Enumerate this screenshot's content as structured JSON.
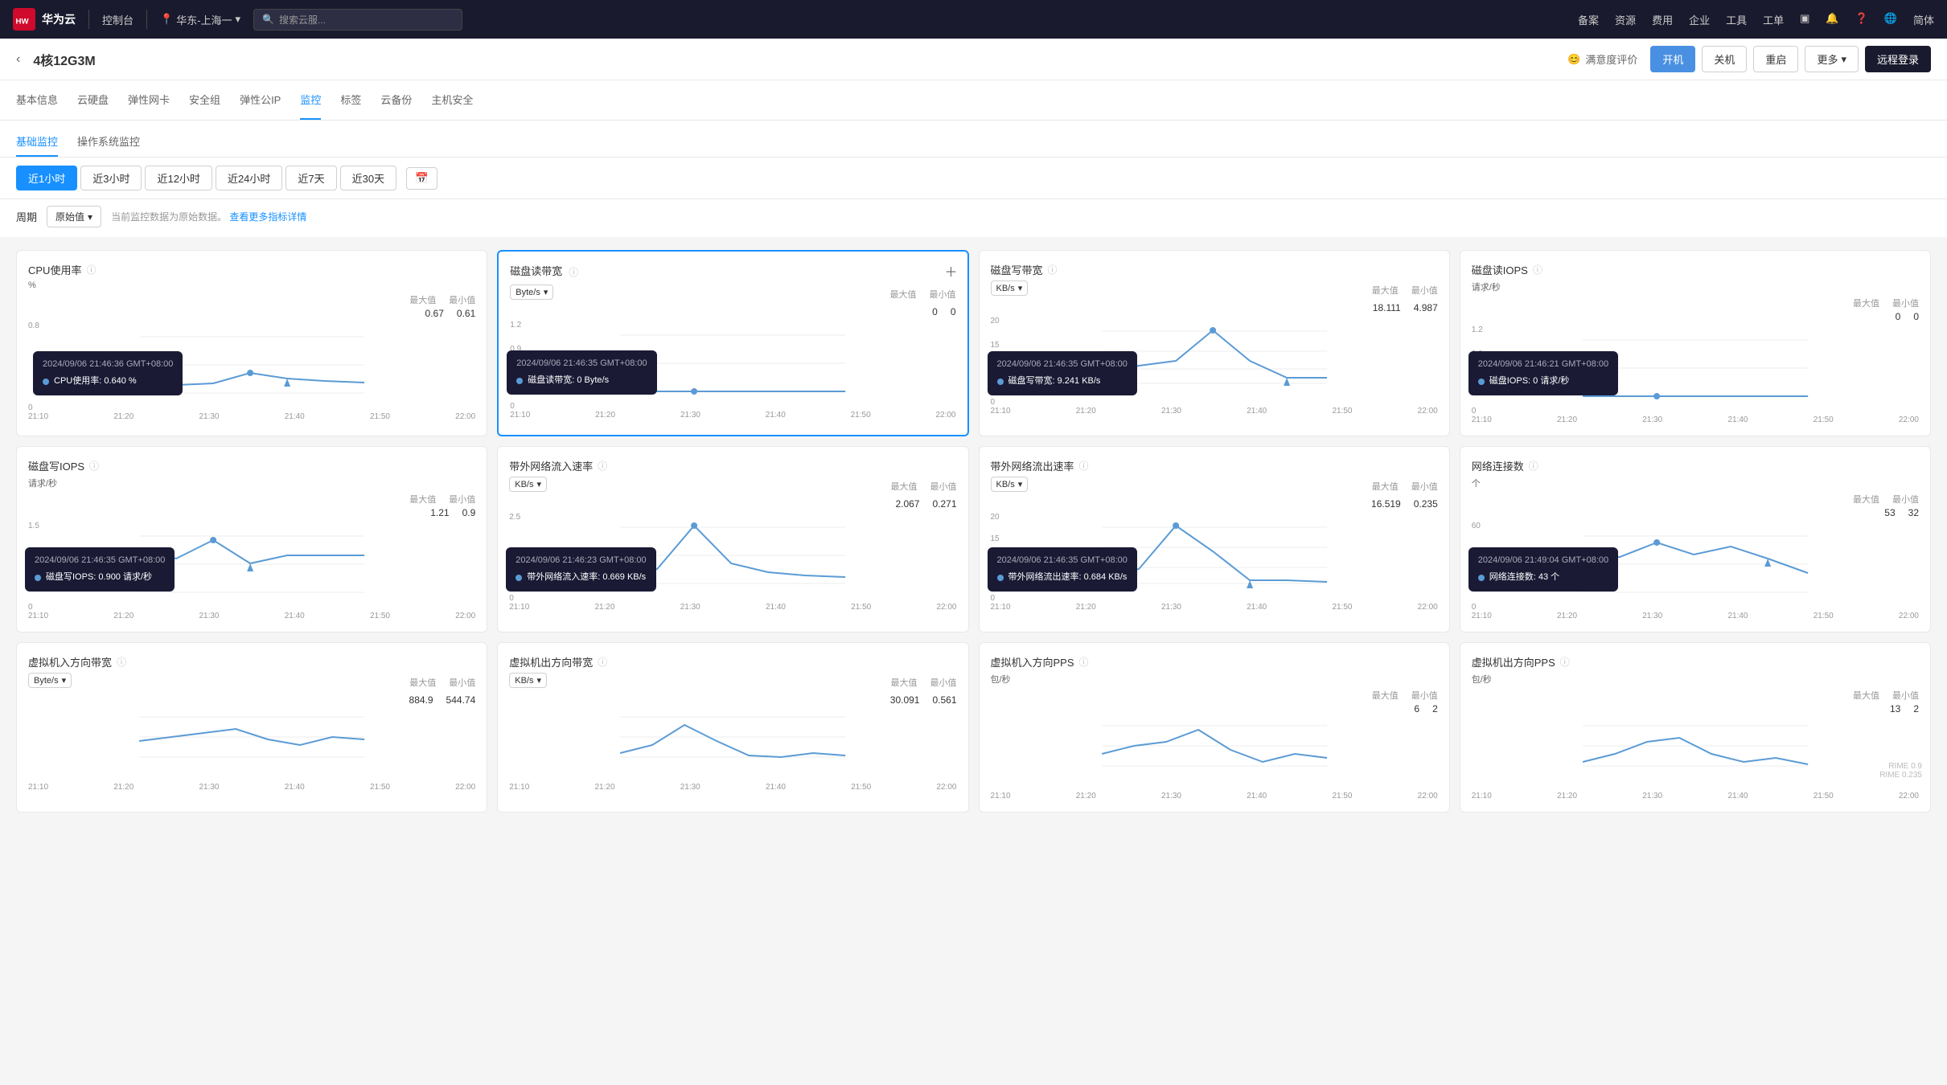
{
  "topNav": {
    "brand": "华为云",
    "controlPanel": "控制台",
    "region": "华东-上海一",
    "searchPlaceholder": "搜索云服...",
    "links": [
      "备案",
      "资源",
      "费用",
      "企业",
      "工具",
      "工单"
    ],
    "lang": "简体"
  },
  "secondBar": {
    "title": "4核12G3M",
    "satisfaction": "满意度评价",
    "btns": {
      "start": "开机",
      "off": "关机",
      "restart": "重启",
      "more": "更多",
      "remote": "远程登录"
    }
  },
  "tabs": [
    "基本信息",
    "云硬盘",
    "弹性网卡",
    "安全组",
    "弹性公IP",
    "监控",
    "标签",
    "云备份",
    "主机安全"
  ],
  "activeTab": "监控",
  "subTabs": [
    "基础监控",
    "操作系统监控"
  ],
  "activeSubTab": "基础监控",
  "timeBtns": [
    "近1小时",
    "近3小时",
    "近12小时",
    "近24小时",
    "近7天",
    "近30天"
  ],
  "activeTimeBtn": "近1小时",
  "period": {
    "label": "周期",
    "value": "原始值",
    "hint": "当前监控数据为原始数据。",
    "link": "查看更多指标详情"
  },
  "charts": [
    {
      "id": "cpu",
      "title": "CPU使用率",
      "unit": "%",
      "maxLabel": "最大值",
      "minLabel": "最小值",
      "maxVal": "0.67",
      "minVal": "0.61",
      "hasSelector": false,
      "hasAdd": false,
      "active": false,
      "tooltip": {
        "time": "2024/09/06 21:46:36 GMT+08:00",
        "items": [
          {
            "label": "CPU使用率: 0.640 %",
            "color": "#5b9bd5"
          }
        ]
      },
      "xLabels": [
        "21:10",
        "21:20",
        "21:30",
        "21:40",
        "21:50",
        "22:00"
      ],
      "yVals": [
        0.61,
        0.62,
        0.63,
        0.67,
        0.64,
        0.63,
        0.62
      ],
      "yMin": 0,
      "yMax": 0.8
    },
    {
      "id": "disk-read-bw",
      "title": "磁盘读带宽",
      "unit": "Byte/s",
      "maxLabel": "最大值",
      "minLabel": "最小值",
      "maxVal": "0",
      "minVal": "0",
      "hasSelector": true,
      "selectorVal": "Byte/s",
      "hasAdd": true,
      "active": true,
      "tooltip": {
        "time": "2024/09/06 21:46:35 GMT+08:00",
        "items": [
          {
            "label": "磁盘读带宽: 0 Byte/s",
            "color": "#5b9bd5"
          }
        ]
      },
      "xLabels": [
        "21:10",
        "21:20",
        "21:30",
        "21:40",
        "21:50",
        "22:00"
      ],
      "yVals": [
        0,
        0,
        0,
        0,
        0,
        0,
        0
      ],
      "yMin": 0,
      "yMax": 1.2
    },
    {
      "id": "disk-write-bw",
      "title": "磁盘写带宽",
      "unit": "KB/s",
      "maxLabel": "最大值",
      "minLabel": "最小值",
      "maxVal": "18.111",
      "minVal": "4.987",
      "hasSelector": true,
      "selectorVal": "KB/s",
      "hasAdd": false,
      "active": false,
      "tooltip": {
        "time": "2024/09/06 21:46:35 GMT+08:00",
        "items": [
          {
            "label": "磁盘写带宽: 9.241 KB/s",
            "color": "#5b9bd5"
          }
        ]
      },
      "xLabels": [
        "21:10",
        "21:20",
        "21:30",
        "21:40",
        "21:50",
        "22:00"
      ],
      "yVals": [
        6,
        8,
        9,
        18,
        9,
        5,
        5
      ],
      "yMin": 0,
      "yMax": 20
    },
    {
      "id": "disk-read-iops",
      "title": "磁盘读IOPS",
      "unit": "请求/秒",
      "maxLabel": "最大值",
      "minLabel": "最小值",
      "maxVal": "0",
      "minVal": "0",
      "hasSelector": false,
      "hasAdd": false,
      "active": false,
      "tooltip": {
        "time": "2024/09/06 21:46:21 GMT+08:00",
        "items": [
          {
            "label": "磁盘IOPS: 0 请求/秒",
            "color": "#5b9bd5"
          }
        ]
      },
      "xLabels": [
        "21:10",
        "21:20",
        "21:30",
        "21:40",
        "21:50",
        "22:00"
      ],
      "yVals": [
        0,
        0,
        0,
        0,
        0,
        0,
        0
      ],
      "yMin": 0,
      "yMax": 1.2
    },
    {
      "id": "disk-write-iops",
      "title": "磁盘写IOPS",
      "unit": "请求/秒",
      "maxLabel": "最大值",
      "minLabel": "最小值",
      "maxVal": "1.21",
      "minVal": "0.9",
      "hasSelector": false,
      "hasAdd": false,
      "active": false,
      "tooltip": {
        "time": "2024/09/06 21:46:35 GMT+08:00",
        "items": [
          {
            "label": "磁盘写IOPS: 0.900 请求/秒",
            "color": "#5b9bd5"
          }
        ]
      },
      "xLabels": [
        "21:10",
        "21:20",
        "21:30",
        "21:40",
        "21:50",
        "22:00"
      ],
      "yVals": [
        1.1,
        0.95,
        1.21,
        0.9,
        1.0,
        1.0,
        1.0
      ],
      "yMin": 0,
      "yMax": 1.5
    },
    {
      "id": "net-in",
      "title": "带外网络流入速率",
      "unit": "KB/s",
      "maxLabel": "最大值",
      "minLabel": "最小值",
      "maxVal": "2.067",
      "minVal": "0.271",
      "hasSelector": true,
      "selectorVal": "KB/s",
      "hasAdd": false,
      "active": false,
      "tooltip": {
        "time": "2024/09/06 21:46:23 GMT+08:00",
        "items": [
          {
            "label": "带外网络流入速率: 0.669 KB/s",
            "color": "#5b9bd5"
          }
        ]
      },
      "xLabels": [
        "21:10",
        "21:20",
        "21:30",
        "21:40",
        "21:50",
        "22:00"
      ],
      "yVals": [
        0.5,
        0.6,
        2.0,
        0.7,
        0.5,
        0.4,
        0.35
      ],
      "yMin": 0,
      "yMax": 2.5
    },
    {
      "id": "net-out",
      "title": "带外网络流出速率",
      "unit": "KB/s",
      "maxLabel": "最大值",
      "minLabel": "最小值",
      "maxVal": "16.519",
      "minVal": "0.235",
      "hasSelector": true,
      "selectorVal": "KB/s",
      "hasAdd": false,
      "active": false,
      "tooltip": {
        "time": "2024/09/06 21:46:35 GMT+08:00",
        "items": [
          {
            "label": "带外网络流出速率: 0.684 KB/s",
            "color": "#5b9bd5"
          }
        ]
      },
      "xLabels": [
        "21:10",
        "21:20",
        "21:30",
        "21:40",
        "21:50",
        "22:00"
      ],
      "yVals": [
        2,
        4,
        16,
        8,
        1,
        1,
        0.5
      ],
      "yMin": 0,
      "yMax": 20
    },
    {
      "id": "net-conn",
      "title": "网络连接数",
      "unit": "个",
      "maxLabel": "最大值",
      "minLabel": "最小值",
      "maxVal": "53",
      "minVal": "32",
      "hasSelector": false,
      "hasAdd": false,
      "active": false,
      "tooltip": {
        "time": "2024/09/06 21:49:04 GMT+08:00",
        "items": [
          {
            "label": "网络连接数: 43 个",
            "color": "#5b9bd5"
          }
        ]
      },
      "xLabels": [
        "21:10",
        "21:20",
        "21:30",
        "21:40",
        "21:50",
        "22:00"
      ],
      "yVals": [
        40,
        43,
        53,
        45,
        50,
        42,
        32
      ],
      "yMin": 0,
      "yMax": 60
    },
    {
      "id": "vm-in-bw",
      "title": "虚拟机入方向带宽",
      "unit": "Byte/s",
      "maxLabel": "最大值",
      "minLabel": "最小值",
      "maxVal": "884.9",
      "minVal": "544.74",
      "hasSelector": true,
      "selectorVal": "Byte/s",
      "hasAdd": false,
      "active": false,
      "tooltip": null,
      "xLabels": [
        "21:10",
        "21:20",
        "21:30",
        "21:40",
        "21:50",
        "22:00"
      ],
      "yVals": [],
      "yMin": 0,
      "yMax": 1000
    },
    {
      "id": "vm-out-bw",
      "title": "虚拟机出方向带宽",
      "unit": "KB/s",
      "maxLabel": "最大值",
      "minLabel": "最小值",
      "maxVal": "30.091",
      "minVal": "0.561",
      "hasSelector": true,
      "selectorVal": "KB/s",
      "hasAdd": false,
      "active": false,
      "tooltip": null,
      "xLabels": [
        "21:10",
        "21:20",
        "21:30",
        "21:40",
        "21:50",
        "22:00"
      ],
      "yVals": [],
      "yMin": 0,
      "yMax": 40
    },
    {
      "id": "vm-in-pps",
      "title": "虚拟机入方向PPS",
      "unit": "包/秒",
      "maxLabel": "最大值",
      "minLabel": "最小值",
      "maxVal": "6",
      "minVal": "2",
      "hasSelector": false,
      "hasAdd": false,
      "active": false,
      "tooltip": null,
      "xLabels": [
        "21:10",
        "21:20",
        "21:30",
        "21:40",
        "21:50",
        "22:00"
      ],
      "yVals": [],
      "yMin": 0,
      "yMax": 8
    },
    {
      "id": "vm-out-pps",
      "title": "虚拟机出方向PPS",
      "unit": "包/秒",
      "maxLabel": "最大值",
      "minLabel": "最小值",
      "maxVal": "13",
      "minVal": "2",
      "hasSelector": false,
      "hasAdd": false,
      "active": false,
      "tooltip": null,
      "xLabels": [
        "21:10",
        "21:20",
        "21:30",
        "21:40",
        "21:50",
        "22:00"
      ],
      "yVals": [],
      "yMin": 0,
      "yMax": 15
    }
  ]
}
